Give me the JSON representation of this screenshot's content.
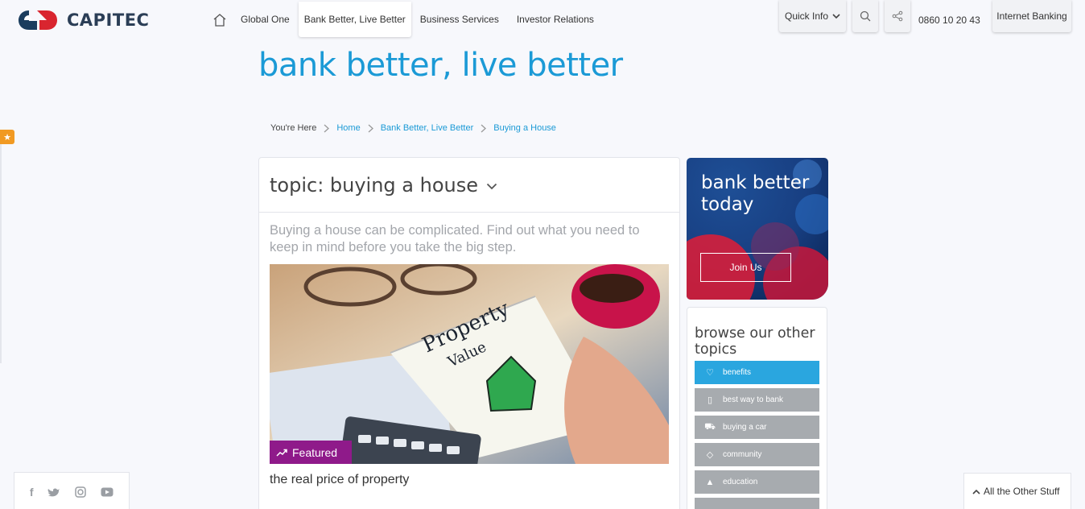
{
  "brand": {
    "name": "CAPITEC"
  },
  "nav": {
    "items": [
      {
        "label": "Global One"
      },
      {
        "label": "Bank Better, Live Better"
      },
      {
        "label": "Business Services"
      },
      {
        "label": "Investor Relations"
      }
    ]
  },
  "header": {
    "quick_info": "Quick Info",
    "phone": "0860 10 20 43",
    "internet_banking": "Internet Banking"
  },
  "hero": {
    "title": "bank better, live better"
  },
  "breadcrumb": {
    "label": "You're Here",
    "items": [
      "Home",
      "Bank Better, Live Better",
      "Buying a House"
    ]
  },
  "topic": {
    "title": "topic: buying a house",
    "intro": "Buying a house can be complicated. Find out what you need to keep in mind before you take the big step."
  },
  "article": {
    "badge": "Featured",
    "title": "the real price of property",
    "image_text_1": "Property",
    "image_text_2": "Value"
  },
  "promo": {
    "heading_line1": "bank better",
    "heading_line2": "today",
    "button": "Join Us"
  },
  "topics_panel": {
    "heading": "browse our other topics",
    "items": [
      {
        "label": "benefits",
        "icon": "heart-hand-icon",
        "active": true
      },
      {
        "label": "best way to bank",
        "icon": "mobile-icon",
        "active": false
      },
      {
        "label": "buying a car",
        "icon": "car-icon",
        "active": false
      },
      {
        "label": "community",
        "icon": "diamond-icon",
        "active": false
      },
      {
        "label": "education",
        "icon": "graduation-cap-icon",
        "active": false
      }
    ]
  },
  "footer": {
    "other_stuff": "All the Other Stuff"
  },
  "colors": {
    "brand_blue": "#1b9ad6",
    "featured": "#8f1a8a",
    "active_topic": "#2aa6df",
    "topic_grey": "#a7abaf"
  }
}
